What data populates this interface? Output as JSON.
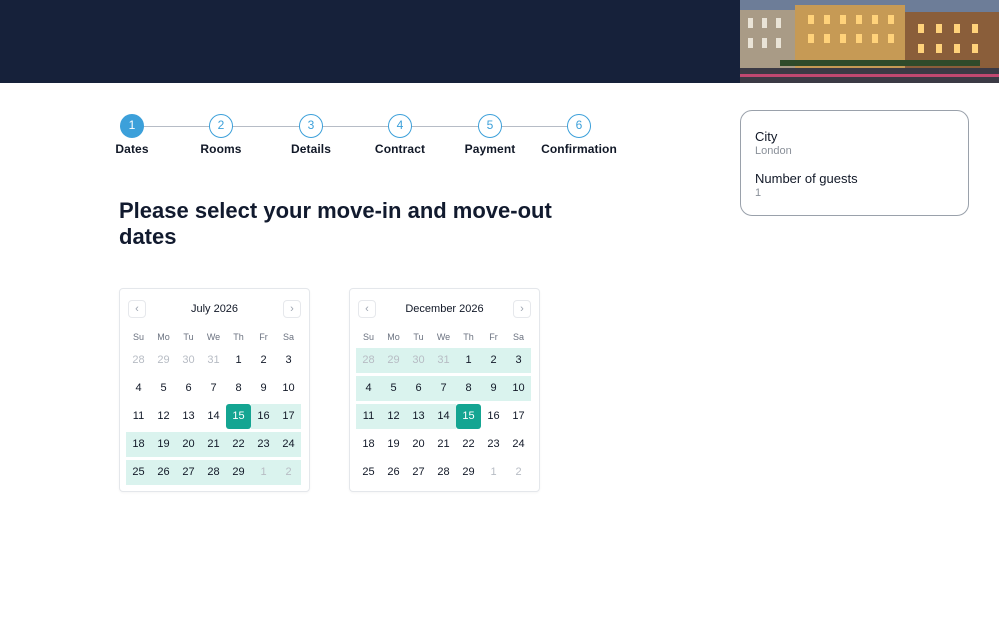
{
  "steps": [
    {
      "num": "1",
      "label": "Dates",
      "active": true
    },
    {
      "num": "2",
      "label": "Rooms",
      "active": false
    },
    {
      "num": "3",
      "label": "Details",
      "active": false
    },
    {
      "num": "4",
      "label": "Contract",
      "active": false
    },
    {
      "num": "5",
      "label": "Payment",
      "active": false
    },
    {
      "num": "6",
      "label": "Confirmation",
      "active": false
    }
  ],
  "page_title": "Please select your move-in and move-out dates",
  "weekdays": [
    "Su",
    "Mo",
    "Tu",
    "We",
    "Th",
    "Fr",
    "Sa"
  ],
  "calendars": [
    {
      "month": "July 2026",
      "prev_icon": "chevron-left-icon",
      "next_icon": "chevron-right-icon",
      "weeks": [
        [
          {
            "d": "28",
            "muted": true
          },
          {
            "d": "29",
            "muted": true
          },
          {
            "d": "30",
            "muted": true
          },
          {
            "d": "31",
            "muted": true
          },
          {
            "d": "1"
          },
          {
            "d": "2"
          },
          {
            "d": "3"
          }
        ],
        [
          {
            "d": "4"
          },
          {
            "d": "5"
          },
          {
            "d": "6"
          },
          {
            "d": "7"
          },
          {
            "d": "8"
          },
          {
            "d": "9"
          },
          {
            "d": "10"
          }
        ],
        [
          {
            "d": "11"
          },
          {
            "d": "12"
          },
          {
            "d": "13"
          },
          {
            "d": "14"
          },
          {
            "d": "15",
            "selected": true
          },
          {
            "d": "16",
            "range": true
          },
          {
            "d": "17",
            "range": true
          }
        ],
        [
          {
            "d": "18",
            "range": true
          },
          {
            "d": "19",
            "range": true
          },
          {
            "d": "20",
            "range": true
          },
          {
            "d": "21",
            "range": true
          },
          {
            "d": "22",
            "range": true
          },
          {
            "d": "23",
            "range": true
          },
          {
            "d": "24",
            "range": true
          }
        ],
        [
          {
            "d": "25",
            "range": true
          },
          {
            "d": "26",
            "range": true
          },
          {
            "d": "27",
            "range": true
          },
          {
            "d": "28",
            "range": true
          },
          {
            "d": "29",
            "range": true
          },
          {
            "d": "1",
            "muted": true,
            "range": true
          },
          {
            "d": "2",
            "muted": true,
            "range": true
          }
        ]
      ]
    },
    {
      "month": "December 2026",
      "prev_icon": "chevron-left-icon",
      "next_icon": "chevron-right-icon",
      "weeks": [
        [
          {
            "d": "28",
            "muted": true,
            "range": true
          },
          {
            "d": "29",
            "muted": true,
            "range": true
          },
          {
            "d": "30",
            "muted": true,
            "range": true
          },
          {
            "d": "31",
            "muted": true,
            "range": true
          },
          {
            "d": "1",
            "range": true
          },
          {
            "d": "2",
            "range": true
          },
          {
            "d": "3",
            "range": true
          }
        ],
        [
          {
            "d": "4",
            "range": true
          },
          {
            "d": "5",
            "range": true
          },
          {
            "d": "6",
            "range": true
          },
          {
            "d": "7",
            "range": true
          },
          {
            "d": "8",
            "range": true
          },
          {
            "d": "9",
            "range": true
          },
          {
            "d": "10",
            "range": true
          }
        ],
        [
          {
            "d": "11",
            "range": true
          },
          {
            "d": "12",
            "range": true
          },
          {
            "d": "13",
            "range": true
          },
          {
            "d": "14",
            "range": true
          },
          {
            "d": "15",
            "selected": true
          },
          {
            "d": "16"
          },
          {
            "d": "17"
          }
        ],
        [
          {
            "d": "18"
          },
          {
            "d": "19"
          },
          {
            "d": "20"
          },
          {
            "d": "21"
          },
          {
            "d": "22"
          },
          {
            "d": "23"
          },
          {
            "d": "24"
          }
        ],
        [
          {
            "d": "25"
          },
          {
            "d": "26"
          },
          {
            "d": "27"
          },
          {
            "d": "28"
          },
          {
            "d": "29"
          },
          {
            "d": "1",
            "muted": true
          },
          {
            "d": "2",
            "muted": true
          }
        ]
      ]
    }
  ],
  "summary": {
    "city_label": "City",
    "city_value": "London",
    "guests_label": "Number of guests",
    "guests_value": "1"
  },
  "colors": {
    "header_bg": "#16213a",
    "step_accent": "#3ca0da",
    "selected_day": "#14a592",
    "range_bg": "#daf3ee"
  }
}
